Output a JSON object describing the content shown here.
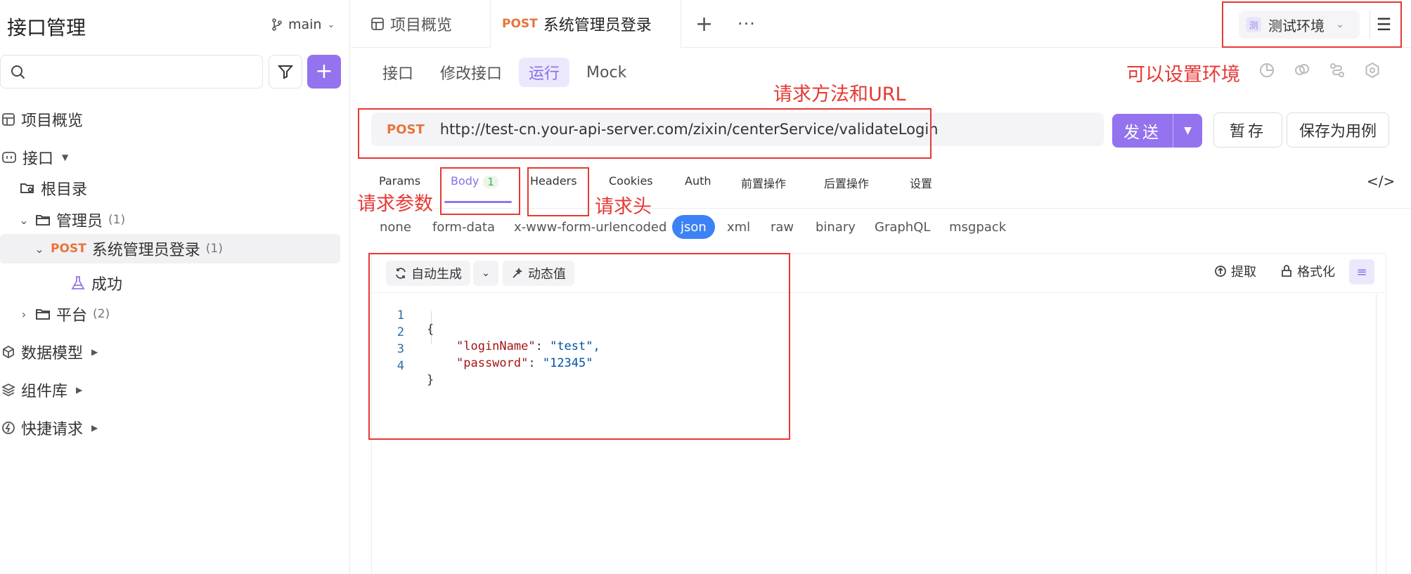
{
  "sidebar": {
    "title": "接口管理",
    "branch": "main",
    "items": [
      {
        "label": "项目概览"
      },
      {
        "label": "接口"
      },
      {
        "label": "根目录"
      },
      {
        "label": "管理员",
        "count": "(1)"
      },
      {
        "method": "POST",
        "label": "系统管理员登录",
        "count": "(1)"
      },
      {
        "label": "成功"
      },
      {
        "label": "平台",
        "count": "(2)"
      },
      {
        "label": "数据模型"
      },
      {
        "label": "组件库"
      },
      {
        "label": "快捷请求"
      }
    ]
  },
  "tabs": {
    "overview": "项目概览",
    "active_method": "POST",
    "active_label": "系统管理员登录",
    "add": "+",
    "more": "···"
  },
  "env": {
    "badge": "测",
    "label": "测试环境"
  },
  "subtabs": [
    "接口",
    "修改接口",
    "运行",
    "Mock"
  ],
  "request": {
    "method": "POST",
    "url": "http://test-cn.your-api-server.com/zixin/centerService/validateLogin",
    "send": "发送",
    "save": "暂存",
    "save_case": "保存为用例"
  },
  "param_tabs": {
    "params": "Params",
    "body": "Body",
    "body_count": "1",
    "headers": "Headers",
    "cookies": "Cookies",
    "auth": "Auth",
    "pre": "前置操作",
    "post": "后置操作",
    "settings": "设置"
  },
  "body_types": [
    "none",
    "form-data",
    "x-www-form-urlencoded",
    "json",
    "xml",
    "raw",
    "binary",
    "GraphQL",
    "msgpack"
  ],
  "editor": {
    "auto_gen": "自动生成",
    "dynamic": "动态值",
    "extract": "提取",
    "format": "格式化",
    "lines": [
      {
        "no": "1",
        "text": "{"
      },
      {
        "no": "2",
        "key": "\"loginName\"",
        "value": "\"test\","
      },
      {
        "no": "3",
        "key": "\"password\"",
        "value": "\"12345\""
      },
      {
        "no": "4",
        "text": "}"
      }
    ]
  },
  "annotations": {
    "env": "可以设置环境",
    "url": "请求方法和URL",
    "body": "请求参数",
    "headers": "请求头"
  },
  "colors": {
    "accent": "#9373ee",
    "post": "#e8743b",
    "annotation": "#e53935",
    "json_active": "#3b82f6"
  }
}
